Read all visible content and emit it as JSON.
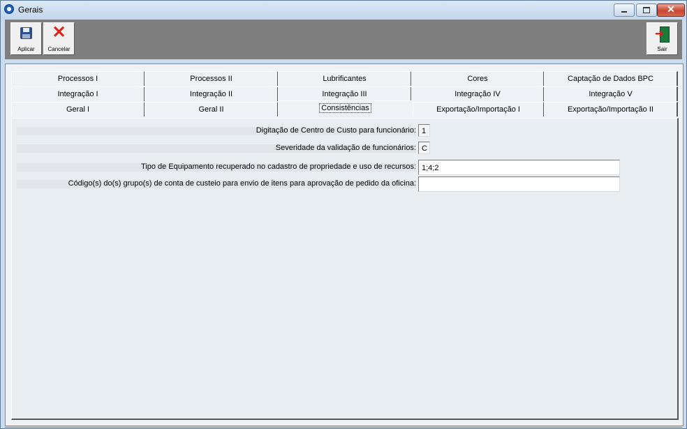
{
  "window": {
    "title": "Gerais"
  },
  "toolbar": {
    "apply_label": "Aplicar",
    "cancel_label": "Cancelar",
    "exit_label": "Sair"
  },
  "tabs": {
    "row1": [
      "Processos I",
      "Processos II",
      "Lubrificantes",
      "Cores",
      "Captação de Dados BPC"
    ],
    "row2": [
      "Integração I",
      "Integração II",
      "Integração III",
      "Integração IV",
      "Integração V"
    ],
    "row3": [
      "Geral I",
      "Geral II",
      "Consistências",
      "Exportação/Importação I",
      "Exportação/Importação II"
    ],
    "active": "Consistências"
  },
  "fields": [
    {
      "label": "Digitação de Centro de Custo para funcionário:",
      "value": "1"
    },
    {
      "label": "Severidade da validação de funcionários:",
      "value": "C"
    },
    {
      "label": "Tipo de Equipamento recuperado no cadastro de propriedade e uso de recursos:",
      "value": "1;4;2"
    },
    {
      "label": "Código(s) do(s) grupo(s) de conta de custeio para envio de itens para aprovação de pedido da oficina:",
      "value": ""
    }
  ],
  "icons": {
    "app": "app-icon",
    "apply": "save-icon",
    "cancel": "cancel-x-icon",
    "exit": "exit-door-icon"
  }
}
